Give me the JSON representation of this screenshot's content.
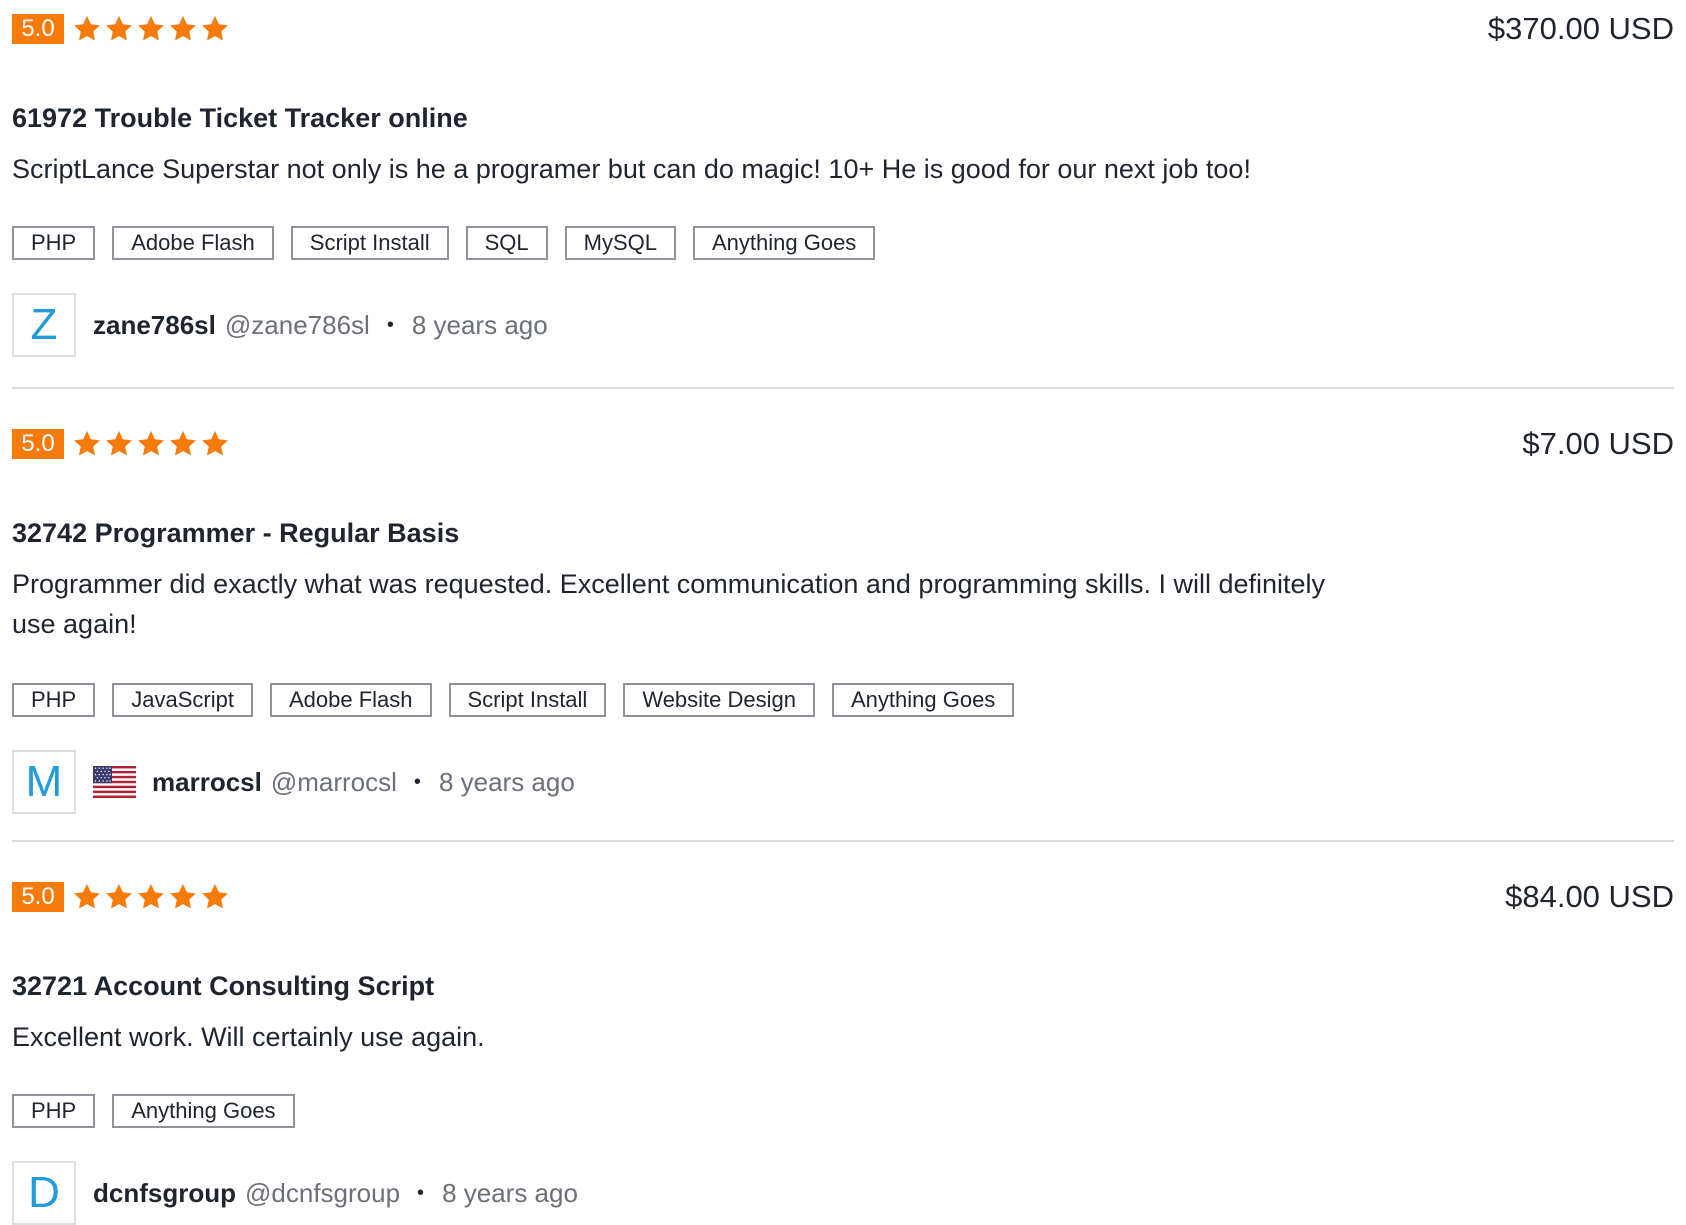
{
  "reviews": [
    {
      "rating": "5.0",
      "stars": 5,
      "price": "$370.00 USD",
      "title": "61972 Trouble Ticket Tracker online",
      "text": "ScriptLance Superstar not only is he a programer but can do magic! 10+ He is good for our next job too!",
      "tags": [
        "PHP",
        "Adobe Flash",
        "Script Install",
        "SQL",
        "MySQL",
        "Anything Goes"
      ],
      "reviewer": {
        "initial": "Z",
        "name": "zane786sl",
        "handle": "@zane786sl",
        "time": "8 years ago",
        "flag": ""
      }
    },
    {
      "rating": "5.0",
      "stars": 5,
      "price": "$7.00 USD",
      "title": "32742 Programmer - Regular Basis",
      "text": "Programmer did exactly what was requested. Excellent communication and programming skills. I will definitely use again!",
      "tags": [
        "PHP",
        "JavaScript",
        "Adobe Flash",
        "Script Install",
        "Website Design",
        "Anything Goes"
      ],
      "reviewer": {
        "initial": "M",
        "name": "marrocsl",
        "handle": "@marrocsl",
        "time": "8 years ago",
        "flag": "us-flag-icon"
      }
    },
    {
      "rating": "5.0",
      "stars": 5,
      "price": "$84.00 USD",
      "title": "32721 Account Consulting Script",
      "text": "Excellent work. Will certainly use again.",
      "tags": [
        "PHP",
        "Anything Goes"
      ],
      "reviewer": {
        "initial": "D",
        "name": "dcnfsgroup",
        "handle": "@dcnfsgroup",
        "time": "8 years ago",
        "flag": ""
      }
    }
  ],
  "separator": "•",
  "icons": {
    "star": "star-icon",
    "flag": "us-flag-icon"
  },
  "colors": {
    "rating_badge": "#f77b0b",
    "star": "#f77b0b",
    "avatar_letter": "#1f9bde",
    "text": "#1f2530",
    "muted_text": "#6b7079",
    "tag_border": "#8f939a",
    "divider": "#dcdcdc"
  }
}
